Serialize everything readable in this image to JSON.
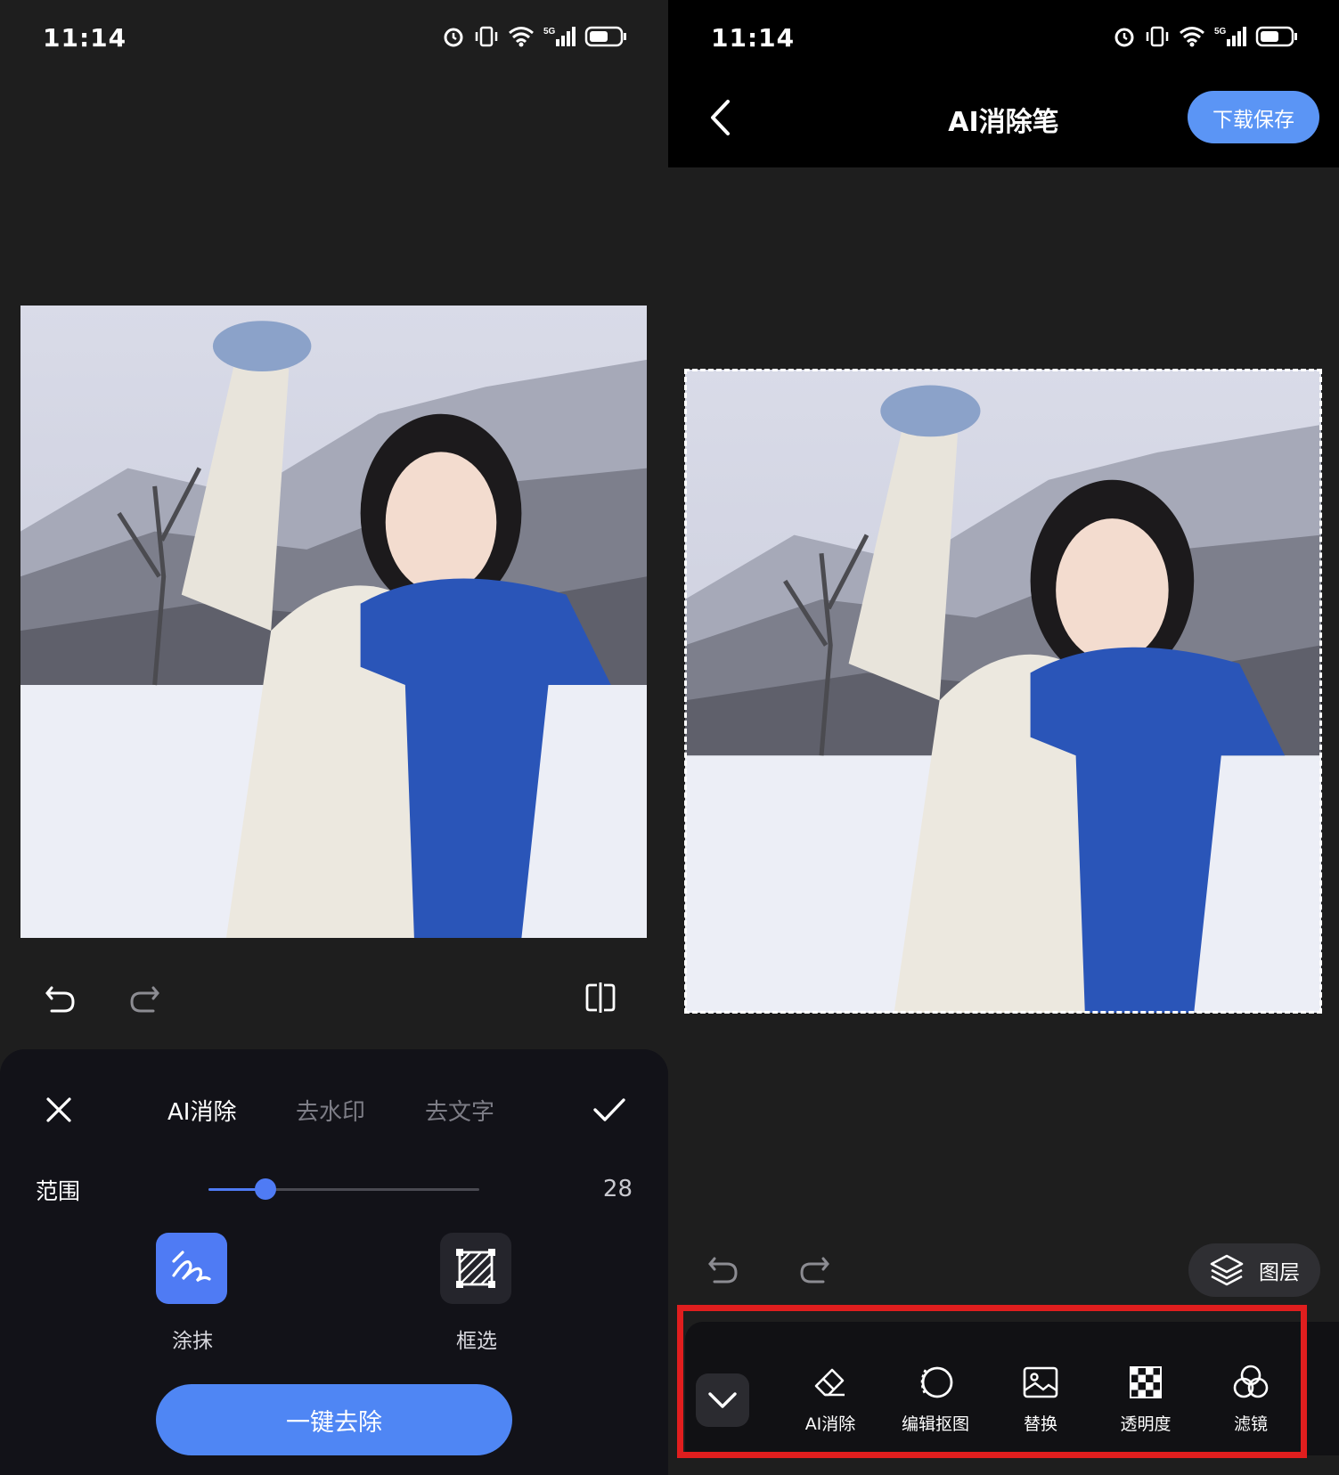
{
  "status_bar": {
    "time": "11:14"
  },
  "left": {
    "tabs": [
      "AI消除",
      "去水印",
      "去文字"
    ],
    "active_tab": "AI消除",
    "range_label": "范围",
    "range_value": "28",
    "range_fraction": 0.21,
    "modes": [
      {
        "label": "涂抹",
        "icon": "brush-icon",
        "active": true
      },
      {
        "label": "框选",
        "icon": "box-select-icon",
        "active": false
      }
    ],
    "primary_button": "一键去除"
  },
  "right": {
    "title": "AI消除笔",
    "save_button": "下载保存",
    "layers_button": "图层",
    "tools": [
      {
        "label": "AI消除",
        "icon": "eraser-icon"
      },
      {
        "label": "编辑抠图",
        "icon": "cutout-icon"
      },
      {
        "label": "替换",
        "icon": "image-replace-icon"
      },
      {
        "label": "透明度",
        "icon": "checkerboard-icon"
      },
      {
        "label": "滤镜",
        "icon": "filter-icon"
      }
    ]
  },
  "colors": {
    "accent": "#4f7bf4",
    "save": "#5b95f5",
    "highlight": "#e01e1e"
  }
}
